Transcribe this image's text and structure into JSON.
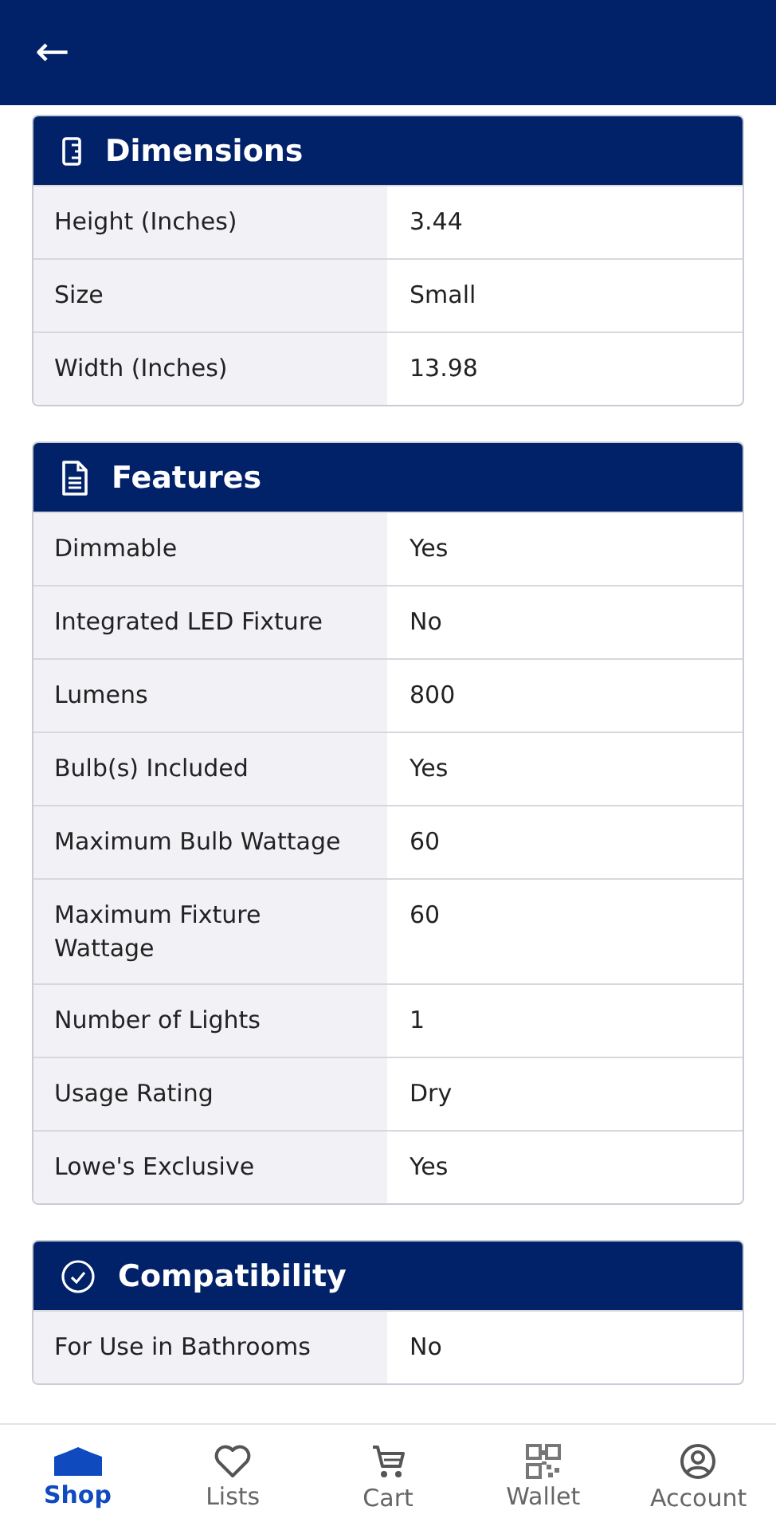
{
  "app_bar": {
    "back": "←"
  },
  "sections": [
    {
      "title": "Dimensions",
      "rows": [
        {
          "label": "Height (Inches)",
          "value": "3.44"
        },
        {
          "label": "Size",
          "value": "Small"
        },
        {
          "label": "Width (Inches)",
          "value": "13.98"
        }
      ]
    },
    {
      "title": "Features",
      "rows": [
        {
          "label": "Dimmable",
          "value": "Yes"
        },
        {
          "label": "Integrated LED Fixture",
          "value": "No"
        },
        {
          "label": "Lumens",
          "value": "800"
        },
        {
          "label": "Bulb(s) Included",
          "value": "Yes"
        },
        {
          "label": "Maximum Bulb Wattage",
          "value": "60"
        },
        {
          "label": "Maximum Fixture Wattage",
          "value": "60"
        },
        {
          "label": "Number of Lights",
          "value": "1"
        },
        {
          "label": "Usage Rating",
          "value": "Dry"
        },
        {
          "label": "Lowe's Exclusive",
          "value": "Yes"
        }
      ]
    },
    {
      "title": "Compatibility",
      "rows": [
        {
          "label": "For Use in Bathrooms",
          "value": "No"
        }
      ]
    }
  ],
  "nav": [
    {
      "label": "Shop",
      "selected": true
    },
    {
      "label": "Lists",
      "selected": false
    },
    {
      "label": "Cart",
      "selected": false
    },
    {
      "label": "Wallet",
      "selected": false
    },
    {
      "label": "Account",
      "selected": false
    }
  ]
}
